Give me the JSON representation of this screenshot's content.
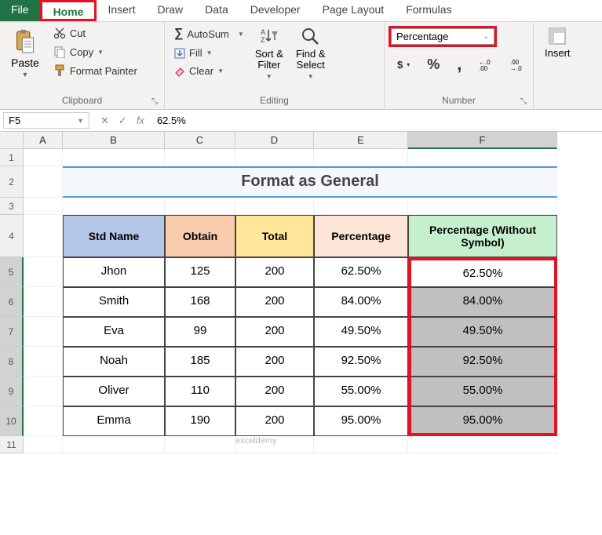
{
  "tabs": {
    "file": "File",
    "home": "Home",
    "insert": "Insert",
    "draw": "Draw",
    "data": "Data",
    "developer": "Developer",
    "pagelayout": "Page Layout",
    "formulas": "Formulas"
  },
  "clipboard": {
    "paste": "Paste",
    "cut": "Cut",
    "copy": "Copy",
    "format_painter": "Format Painter",
    "group": "Clipboard"
  },
  "editing": {
    "autosum": "AutoSum",
    "fill": "Fill",
    "clear": "Clear",
    "sort_filter": "Sort &\nFilter",
    "find_select": "Find &\nSelect",
    "group": "Editing"
  },
  "number": {
    "format": "Percentage",
    "dollar": "$",
    "percent": "%",
    "comma": ",",
    "inc_dec": ".00",
    "group": "Number"
  },
  "cells": {
    "insert": "Insert"
  },
  "name_box": "F5",
  "formula": "62.5%",
  "columns": [
    "A",
    "B",
    "C",
    "D",
    "E",
    "F"
  ],
  "rows": [
    "1",
    "2",
    "3",
    "4",
    "5",
    "6",
    "7",
    "8",
    "9",
    "10",
    "11"
  ],
  "title": "Format as General",
  "headers": {
    "name": "Std Name",
    "obtain": "Obtain",
    "total": "Total",
    "pct": "Percentage",
    "pct_no": "Percentage (Without Symbol)"
  },
  "data": [
    {
      "name": "Jhon",
      "obtain": "125",
      "total": "200",
      "pct": "62.50%",
      "pct_no": "62.50%"
    },
    {
      "name": "Smith",
      "obtain": "168",
      "total": "200",
      "pct": "84.00%",
      "pct_no": "84.00%"
    },
    {
      "name": "Eva",
      "obtain": "99",
      "total": "200",
      "pct": "49.50%",
      "pct_no": "49.50%"
    },
    {
      "name": "Noah",
      "obtain": "185",
      "total": "200",
      "pct": "92.50%",
      "pct_no": "92.50%"
    },
    {
      "name": "Oliver",
      "obtain": "110",
      "total": "200",
      "pct": "55.00%",
      "pct_no": "55.00%"
    },
    {
      "name": "Emma",
      "obtain": "190",
      "total": "200",
      "pct": "95.00%",
      "pct_no": "95.00%"
    }
  ],
  "watermark": "exceldemy"
}
